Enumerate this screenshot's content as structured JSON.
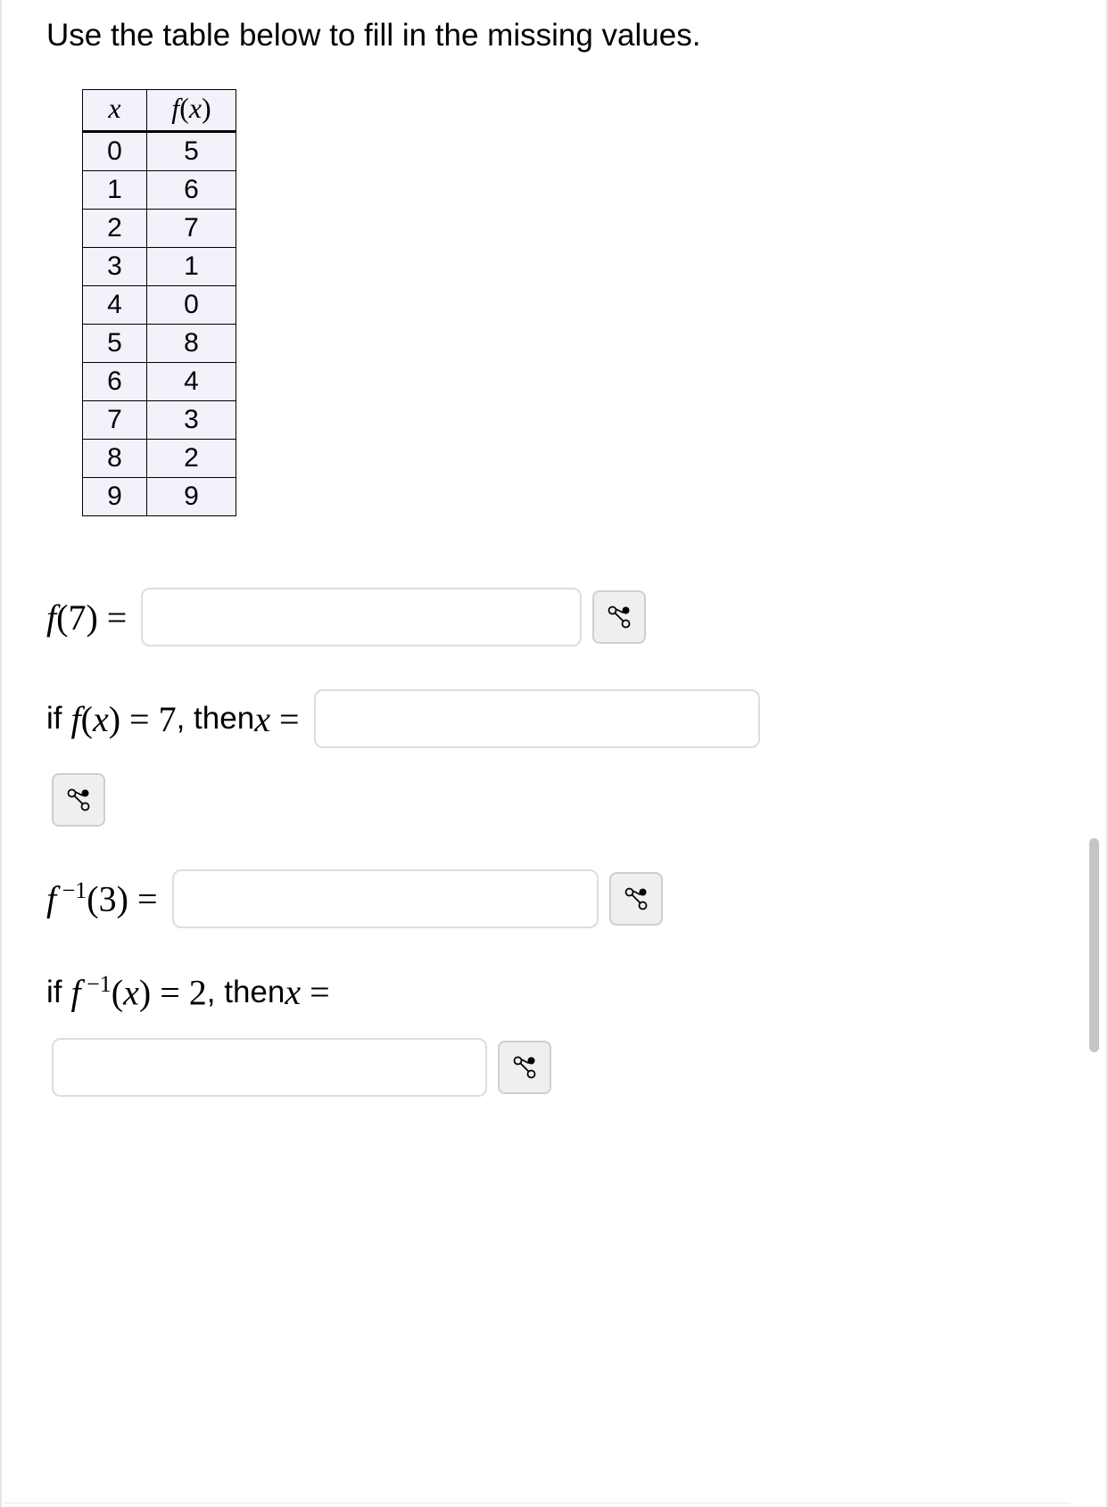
{
  "prompt": "Use the table below to fill in the missing values.",
  "table": {
    "headers": {
      "x": "x",
      "fx": "f(x)"
    },
    "rows": [
      {
        "x": "0",
        "fx": "5"
      },
      {
        "x": "1",
        "fx": "6"
      },
      {
        "x": "2",
        "fx": "7"
      },
      {
        "x": "3",
        "fx": "1"
      },
      {
        "x": "4",
        "fx": "0"
      },
      {
        "x": "5",
        "fx": "8"
      },
      {
        "x": "6",
        "fx": "4"
      },
      {
        "x": "7",
        "fx": "3"
      },
      {
        "x": "8",
        "fx": "2"
      },
      {
        "x": "9",
        "fx": "9"
      }
    ]
  },
  "questions": {
    "q1": {
      "label_lhs": "f(7) =",
      "value": ""
    },
    "q2": {
      "prefix": "if ",
      "cond": "f(x) = 7",
      "mid": ", then ",
      "lhs": "x =",
      "value": ""
    },
    "q3": {
      "label_lhs": "f⁻¹(3) =",
      "value": ""
    },
    "q4": {
      "prefix": "if ",
      "cond": "f⁻¹(x) = 2",
      "mid": ", then ",
      "lhs": "x =",
      "value": ""
    }
  },
  "icons": {
    "symbol_toggle": "symbol-palette-icon"
  }
}
